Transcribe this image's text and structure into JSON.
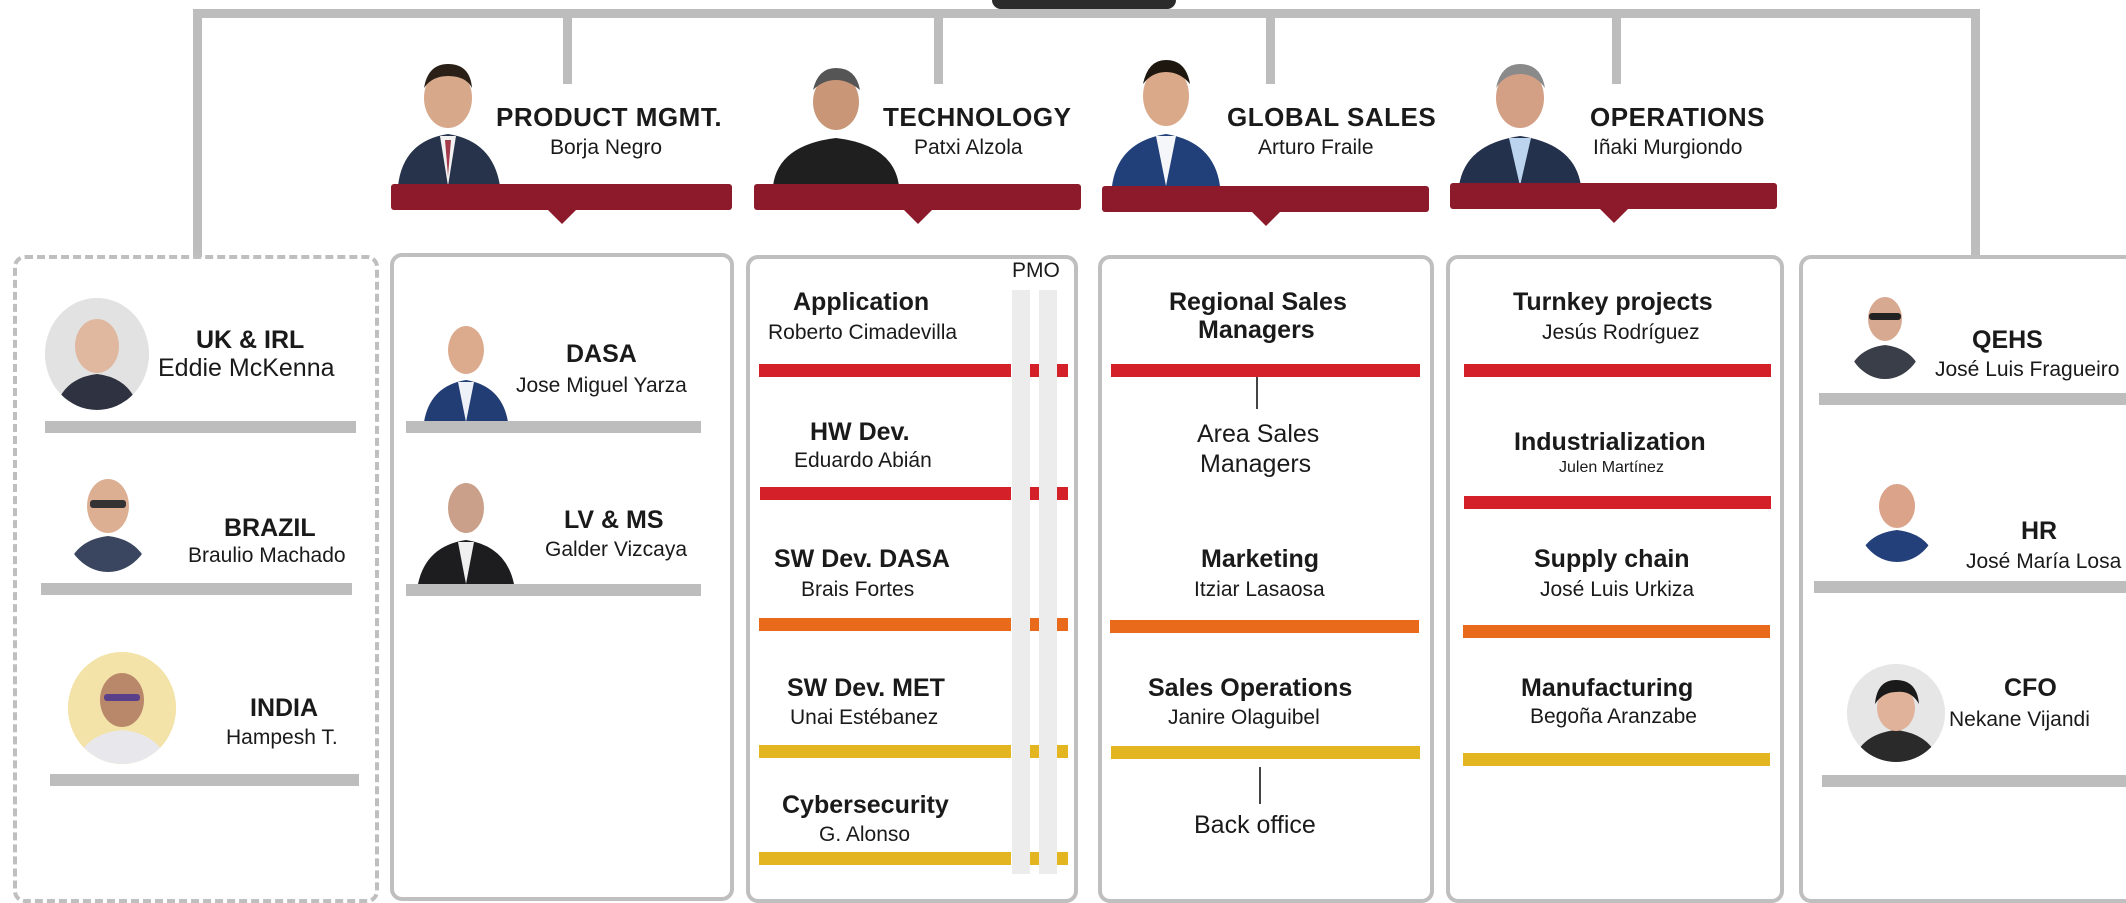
{
  "colors": {
    "connector": "#bdbdbd",
    "header_bar": "#8c1a2a",
    "red": "#d42028",
    "orange": "#e86a1a",
    "yellow": "#e2b521",
    "box_border": "#bfbfbf"
  },
  "heads": [
    {
      "title": "PRODUCT MGMT.",
      "name": "Borja Negro"
    },
    {
      "title": "TECHNOLOGY",
      "name": "Patxi Alzola"
    },
    {
      "title": "GLOBAL SALES",
      "name": "Arturo Fraile"
    },
    {
      "title": "OPERATIONS",
      "name": "Iñaki Murgiondo"
    }
  ],
  "regions": [
    {
      "title": "UK & IRL",
      "name": "Eddie McKenna"
    },
    {
      "title": "BRAZIL",
      "name": "Braulio Machado"
    },
    {
      "title": "INDIA",
      "name": "Hampesh T."
    }
  ],
  "product": [
    {
      "title": "DASA",
      "name": "Jose Miguel Yarza"
    },
    {
      "title": "LV & MS",
      "name": "Galder Vizcaya"
    }
  ],
  "technology": {
    "pmo_label": "PMO",
    "items": [
      {
        "title": "Application",
        "name": "Roberto Cimadevilla"
      },
      {
        "title": "HW Dev.",
        "name": "Eduardo Abián"
      },
      {
        "title": "SW Dev. DASA",
        "name": "Brais Fortes"
      },
      {
        "title": "SW Dev. MET",
        "name": "Unai Estébanez"
      },
      {
        "title": "Cybersecurity",
        "name": "G. Alonso"
      }
    ]
  },
  "sales": {
    "regional_line1": "Regional Sales",
    "regional_line2": "Managers",
    "area_line1": "Area Sales",
    "area_line2": "Managers",
    "marketing_title": "Marketing",
    "marketing_name": "Itziar Lasaosa",
    "ops_title": "Sales Operations",
    "ops_name": "Janire Olaguibel",
    "back_office": "Back office"
  },
  "operations": [
    {
      "title": "Turnkey projects",
      "name": "Jesús Rodríguez"
    },
    {
      "title": "Industrialization",
      "name": "Julen Martínez"
    },
    {
      "title": "Supply chain",
      "name": "José Luis Urkiza"
    },
    {
      "title": "Manufacturing",
      "name": "Begoña Aranzabe"
    }
  ],
  "corporate": [
    {
      "title": "QEHS",
      "name": "José Luis  Fragueiro"
    },
    {
      "title": "HR",
      "name": "José María Losa"
    },
    {
      "title": "CFO",
      "name": "Nekane Vijandi"
    }
  ]
}
